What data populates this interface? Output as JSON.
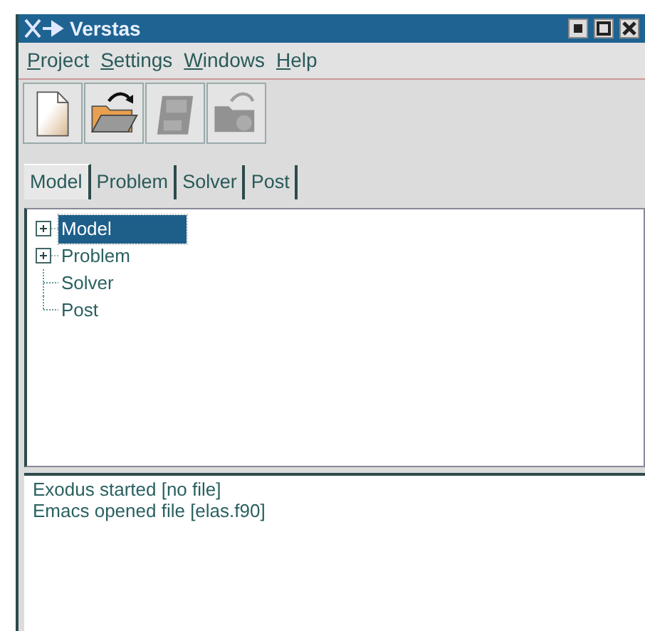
{
  "window": {
    "title": "Verstas"
  },
  "menu": [
    {
      "accel": "P",
      "rest": "roject"
    },
    {
      "accel": "S",
      "rest": "ettings"
    },
    {
      "accel": "W",
      "rest": "indows"
    },
    {
      "accel": "H",
      "rest": "elp"
    }
  ],
  "toolbar": [
    {
      "kind": "new",
      "disabled": false
    },
    {
      "kind": "open",
      "disabled": false
    },
    {
      "kind": "save",
      "disabled": true
    },
    {
      "kind": "export",
      "disabled": true
    }
  ],
  "tabs": [
    {
      "label": "Model",
      "selected": true
    },
    {
      "label": "Problem",
      "selected": false
    },
    {
      "label": "Solver",
      "selected": false
    },
    {
      "label": "Post",
      "selected": false
    }
  ],
  "tree": [
    {
      "label": "Model",
      "kind": "folder",
      "selected": true
    },
    {
      "label": "Problem",
      "kind": "folder",
      "selected": false
    },
    {
      "label": "Solver",
      "kind": "leaf",
      "selected": false
    },
    {
      "label": "Post",
      "kind": "leaf",
      "selected": false
    }
  ],
  "log": [
    "Exodus started [no file]",
    "Emacs opened file [elas.f90]"
  ]
}
